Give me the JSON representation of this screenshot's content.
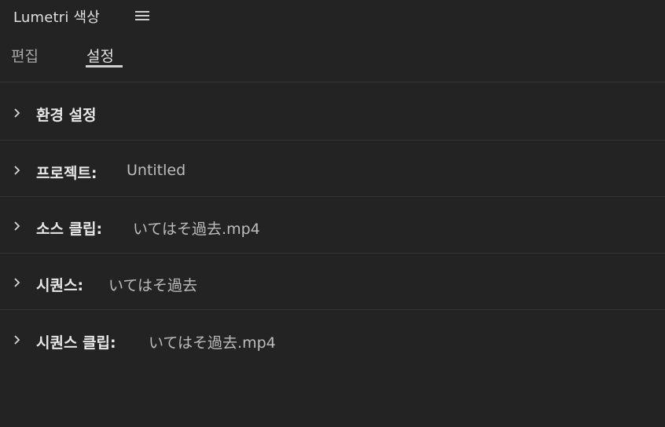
{
  "panel": {
    "title": "Lumetri 색상"
  },
  "tabs": [
    {
      "label": "편집",
      "active": false
    },
    {
      "label": "설정",
      "active": true
    }
  ],
  "sections": [
    {
      "label": "환경 설정",
      "value": ""
    },
    {
      "label": "프로젝트:",
      "value": "Untitled"
    },
    {
      "label": "소스 클립:",
      "value": "いてはそ過去.mp4"
    },
    {
      "label": "시퀀스:",
      "value": "いてはそ過去"
    },
    {
      "label": "시퀀스 클립:",
      "value": "いてはそ過去.mp4"
    }
  ],
  "icons": {
    "menu": "hamburger-menu-icon",
    "expand": "chevron-right-icon"
  },
  "colors": {
    "background": "#232323",
    "divider": "#363636",
    "active_tab_underline": "#d0d0d0"
  }
}
